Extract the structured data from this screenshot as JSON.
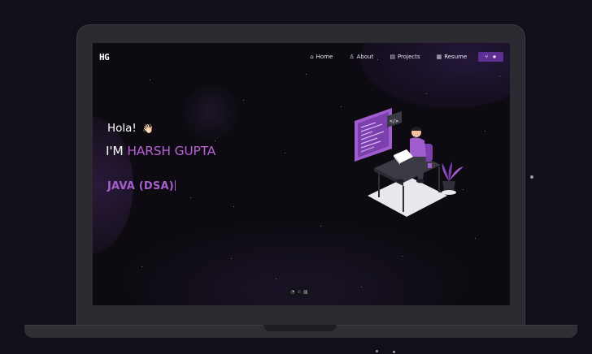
{
  "brand": {
    "logo_text": "HG"
  },
  "nav": {
    "items": [
      {
        "label": "Home",
        "icon": "home-icon",
        "glyph": "⌂"
      },
      {
        "label": "About",
        "icon": "user-icon",
        "glyph": "♙"
      },
      {
        "label": "Projects",
        "icon": "projects-icon",
        "glyph": "▤"
      },
      {
        "label": "Resume",
        "icon": "document-icon",
        "glyph": "▦"
      }
    ],
    "toggle": {
      "icon_left": "⑂",
      "icon_right": "★"
    }
  },
  "hero": {
    "greeting": "Hola!",
    "wave_emoji": "👋🏻",
    "intro_prefix": "I'M",
    "name": "HARSH GUPTA",
    "typed_text": "JAVA (DSA)"
  },
  "footer": {
    "icons": [
      "◔",
      "♧",
      "▥"
    ]
  },
  "colors": {
    "accent": "#b862d6",
    "toggle_bg": "#5d2f93",
    "screen_bg": "#0d0b11",
    "page_bg": "#120f19"
  }
}
